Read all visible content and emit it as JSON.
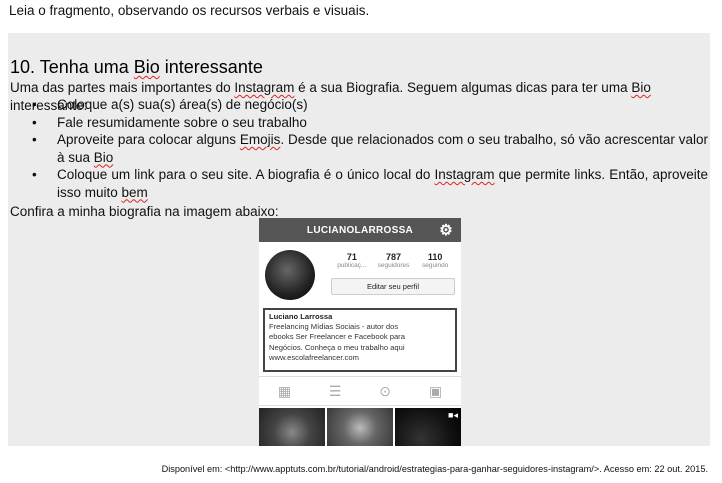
{
  "intro": "Leia o fragmento, observando os recursos verbais e visuais.",
  "heading": {
    "prefix": "10. Tenha uma ",
    "bio_word": "Bio",
    "suffix": " interessante"
  },
  "paragraph1": {
    "part1": "Uma das partes mais importantes do ",
    "instagram": "Instagram",
    "part2": " é a sua Biografia. Seguem algumas dicas para ter uma ",
    "bio": "Bio",
    "part3": " interessante:"
  },
  "tips": [
    {
      "text": "Coloque a(s) sua(s) área(s) de negócio(s)"
    },
    {
      "text": "Fale resumidamente sobre o seu trabalho"
    },
    {
      "part1": "Aproveite para colocar alguns ",
      "emojis": "Emojis",
      "part2": ". Desde que relacionados com o seu trabalho, só vão acrescentar valor à sua ",
      "bio": "Bio"
    },
    {
      "part1": "Coloque um link para o seu site. A biografia é o único local do ",
      "instagram": "Instagram",
      "part2": " que permite links. Então, aproveite isso muito ",
      "bem": "bem"
    }
  ],
  "paragraph2": "Confira a minha biografia na imagem abaixo:",
  "phone": {
    "username": "LUCIANOLARROSSA",
    "stats": [
      {
        "num": "71",
        "label": "publicaç..."
      },
      {
        "num": "787",
        "label": "seguidores"
      },
      {
        "num": "110",
        "label": "seguindo"
      }
    ],
    "edit_label": "Editar seu perfil",
    "bio_name": "Luciano Larrossa",
    "bio_lines": [
      "Freelancing Mídias Sociais - autor dos",
      "ebooks Ser Freelancer e Facebook para",
      "Negócios. Conheça o meu trabalho aqui",
      "www.escolafreelancer.com"
    ]
  },
  "source": "Disponível em: <http://www.apptuts.com.br/tutorial/android/estrategias-para-ganhar-seguidores-instagram/>. Acesso em: 22 out. 2015."
}
